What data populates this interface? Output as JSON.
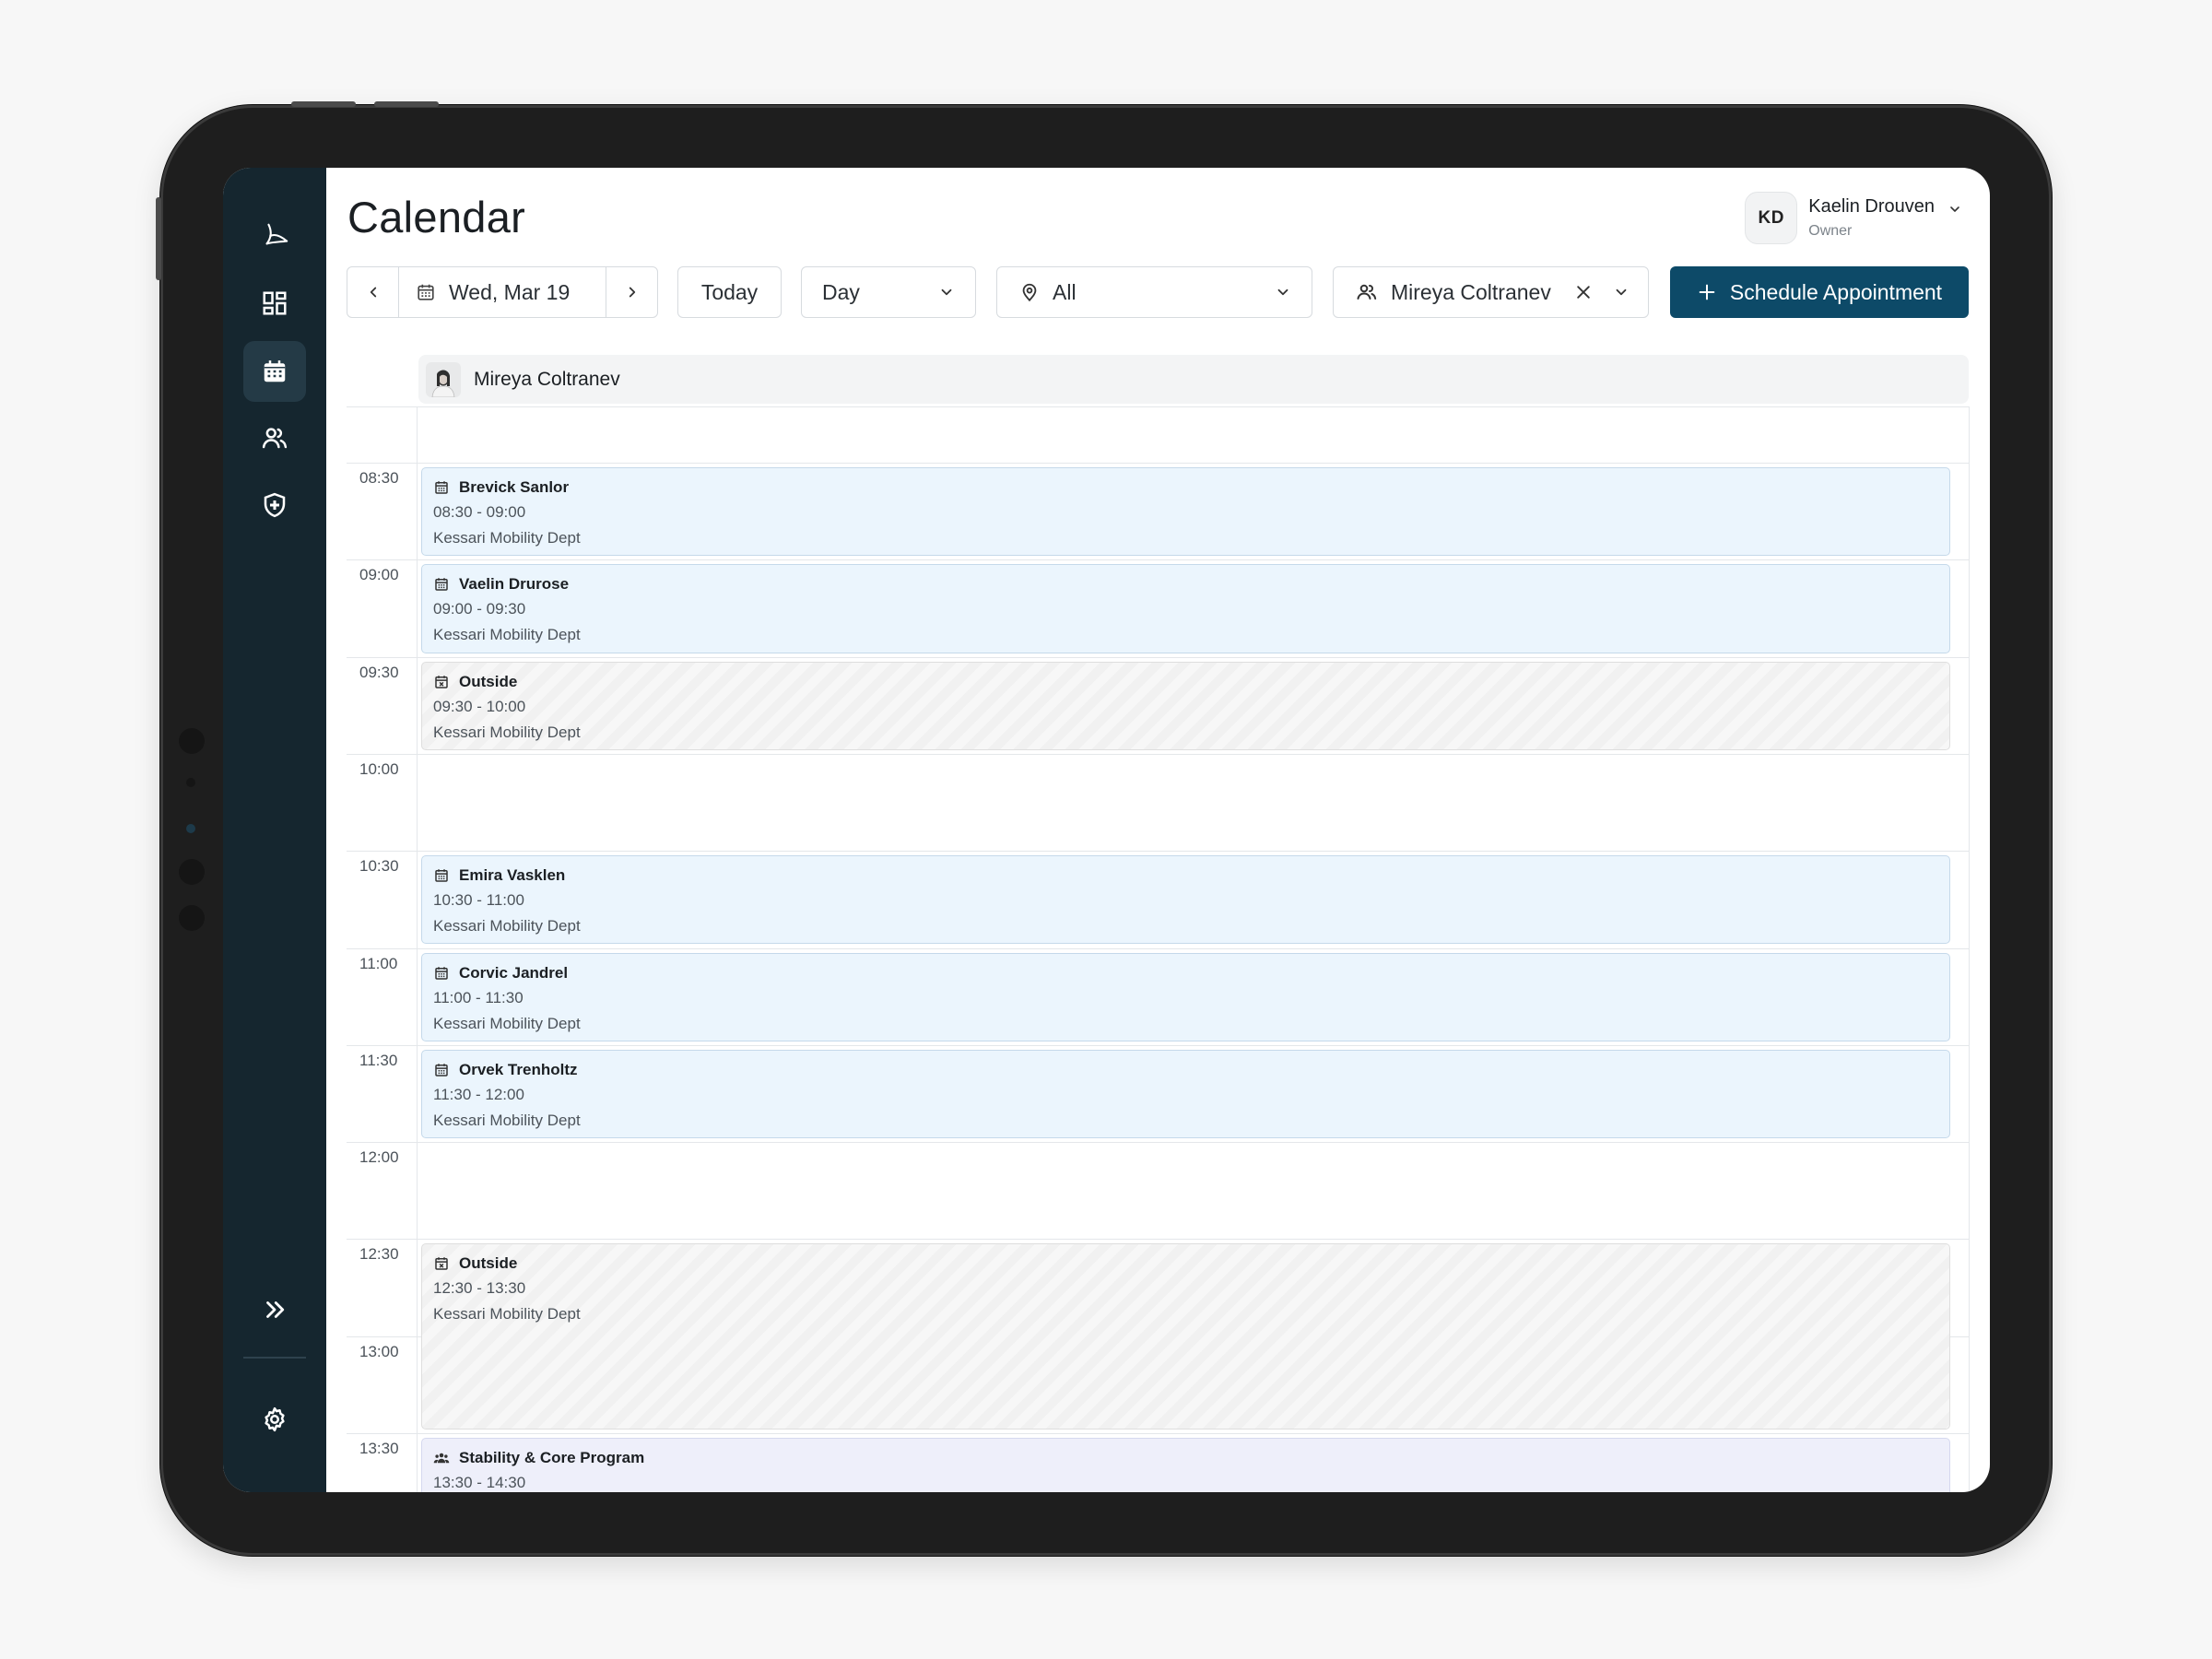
{
  "page": {
    "title": "Calendar"
  },
  "user": {
    "initials": "KD",
    "name": "Kaelin Drouven",
    "role": "Owner"
  },
  "toolbar": {
    "date_label": "Wed, Mar 19",
    "today_label": "Today",
    "view_value": "Day",
    "location_value": "All",
    "staff_value": "Mireya Coltranev",
    "schedule_label": "Schedule Appointment"
  },
  "column": {
    "staff_name": "Mireya Coltranev"
  },
  "times": [
    "08:30",
    "09:00",
    "09:30",
    "10:00",
    "10:30",
    "11:00",
    "11:30",
    "12:00",
    "12:30",
    "13:00",
    "13:30"
  ],
  "events": [
    {
      "title": "Brevick Sanlor",
      "time": "08:30 - 09:00",
      "dept": "Kessari Mobility Dept",
      "type": "appointment"
    },
    {
      "title": "Vaelin Drurose",
      "time": "09:00 - 09:30",
      "dept": "Kessari Mobility Dept",
      "type": "appointment"
    },
    {
      "title": "Outside",
      "time": "09:30 - 10:00",
      "dept": "Kessari Mobility Dept",
      "type": "outside"
    },
    {
      "title": "Emira Vasklen",
      "time": "10:30 - 11:00",
      "dept": "Kessari Mobility Dept",
      "type": "appointment"
    },
    {
      "title": "Corvic Jandrel",
      "time": "11:00 - 11:30",
      "dept": "Kessari Mobility Dept",
      "type": "appointment"
    },
    {
      "title": "Orvek Trenholtz",
      "time": "11:30 - 12:00",
      "dept": "Kessari Mobility Dept",
      "type": "appointment"
    },
    {
      "title": "Outside",
      "time": "12:30 - 13:30",
      "dept": "Kessari Mobility Dept",
      "type": "outside"
    },
    {
      "title": "Stability & Core Program",
      "time": "13:30 - 14:30",
      "type": "group"
    }
  ],
  "icons": {
    "sidebar": [
      "logo-icon",
      "dashboard-icon",
      "calendar-icon",
      "users-icon",
      "shield-icon",
      "expand-icon",
      "gear-icon"
    ]
  },
  "colors": {
    "sidebar": "#15262f",
    "primary": "#0d4a68",
    "appointment_bg": "#ebf5fd",
    "group_bg": "#eeeffa"
  }
}
